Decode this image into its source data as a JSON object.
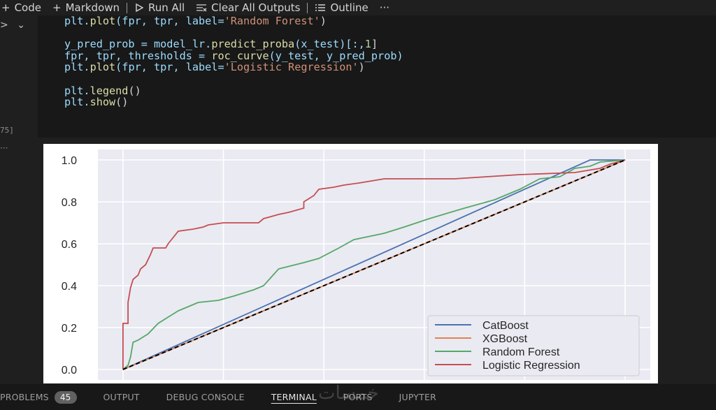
{
  "toolbar": {
    "code_label": "Code",
    "markdown_label": "Markdown",
    "run_all_label": "Run All",
    "clear_outputs_label": "Clear All Outputs",
    "outline_label": "Outline",
    "more_label": "···"
  },
  "cell": {
    "execution_count": "75]",
    "lines": {
      "l1": {
        "a": "plt.",
        "b": "plot",
        "c": "(fpr, tpr, label=",
        "d": "'Random Forest'",
        "e": ")"
      },
      "l3": {
        "a": "y_pred_prob = model_lr.",
        "b": "predict_proba",
        "c": "(x_test)[:,",
        "d": "1",
        "e": "]"
      },
      "l4": {
        "a": "fpr, tpr, thresholds = ",
        "b": "roc_curve",
        "c": "(y_test, y_pred_prob)"
      },
      "l5": {
        "a": "plt.",
        "b": "plot",
        "c": "(fpr, tpr, label=",
        "d": "'Logistic Regression'",
        "e": ")"
      },
      "l7": {
        "a": "plt.",
        "b": "legend",
        "c": "()"
      },
      "l8": {
        "a": "plt.",
        "b": "show",
        "c": "()"
      }
    }
  },
  "output_gutter": "···",
  "chart_data": {
    "type": "line",
    "xlim": [
      -0.05,
      1.05
    ],
    "ylim": [
      -0.05,
      1.05
    ],
    "y_ticks": [
      "0.0",
      "0.2",
      "0.4",
      "0.6",
      "0.8",
      "1.0"
    ],
    "y_tick_values": [
      0,
      0.2,
      0.4,
      0.6,
      0.8,
      1.0
    ],
    "x_grid_values": [
      0,
      0.2,
      0.4,
      0.6,
      0.8,
      1.0
    ],
    "grid": true,
    "background": "#eaeaf2",
    "legend_position": "lower-right",
    "series": [
      {
        "name": "CatBoost",
        "color": "#4c72b0",
        "points": [
          [
            0,
            0
          ],
          [
            0.93,
            1.0
          ],
          [
            1.0,
            1.0
          ]
        ]
      },
      {
        "name": "XGBoost",
        "color": "#dd8452",
        "points": [
          [
            0,
            0
          ],
          [
            1.0,
            1.0
          ]
        ]
      },
      {
        "name": "Random Forest",
        "color": "#55a868",
        "points": [
          [
            0,
            0
          ],
          [
            0.01,
            0.02
          ],
          [
            0.015,
            0.06
          ],
          [
            0.02,
            0.13
          ],
          [
            0.03,
            0.14
          ],
          [
            0.05,
            0.17
          ],
          [
            0.07,
            0.22
          ],
          [
            0.09,
            0.25
          ],
          [
            0.11,
            0.28
          ],
          [
            0.13,
            0.3
          ],
          [
            0.15,
            0.32
          ],
          [
            0.19,
            0.33
          ],
          [
            0.22,
            0.35
          ],
          [
            0.26,
            0.38
          ],
          [
            0.28,
            0.4
          ],
          [
            0.31,
            0.48
          ],
          [
            0.36,
            0.51
          ],
          [
            0.39,
            0.53
          ],
          [
            0.43,
            0.58
          ],
          [
            0.46,
            0.62
          ],
          [
            0.52,
            0.65
          ],
          [
            0.56,
            0.68
          ],
          [
            0.61,
            0.72
          ],
          [
            0.68,
            0.77
          ],
          [
            0.74,
            0.81
          ],
          [
            0.79,
            0.86
          ],
          [
            0.83,
            0.91
          ],
          [
            0.87,
            0.92
          ],
          [
            0.9,
            0.96
          ],
          [
            0.93,
            0.97
          ],
          [
            0.95,
            0.99
          ],
          [
            1.0,
            1.0
          ]
        ]
      },
      {
        "name": "Logistic Regression",
        "color": "#c44e52",
        "points": [
          [
            0,
            0
          ],
          [
            0.0,
            0.22
          ],
          [
            0.01,
            0.22
          ],
          [
            0.01,
            0.32
          ],
          [
            0.015,
            0.39
          ],
          [
            0.02,
            0.43
          ],
          [
            0.03,
            0.45
          ],
          [
            0.035,
            0.48
          ],
          [
            0.045,
            0.5
          ],
          [
            0.055,
            0.55
          ],
          [
            0.06,
            0.58
          ],
          [
            0.085,
            0.58
          ],
          [
            0.09,
            0.6
          ],
          [
            0.1,
            0.63
          ],
          [
            0.11,
            0.66
          ],
          [
            0.14,
            0.67
          ],
          [
            0.16,
            0.68
          ],
          [
            0.17,
            0.69
          ],
          [
            0.2,
            0.7
          ],
          [
            0.27,
            0.7
          ],
          [
            0.28,
            0.72
          ],
          [
            0.31,
            0.74
          ],
          [
            0.33,
            0.75
          ],
          [
            0.36,
            0.77
          ],
          [
            0.36,
            0.8
          ],
          [
            0.38,
            0.83
          ],
          [
            0.39,
            0.86
          ],
          [
            0.42,
            0.87
          ],
          [
            0.44,
            0.88
          ],
          [
            0.47,
            0.89
          ],
          [
            0.52,
            0.91
          ],
          [
            0.66,
            0.91
          ],
          [
            0.79,
            0.93
          ],
          [
            0.9,
            0.94
          ],
          [
            0.95,
            0.96
          ],
          [
            0.97,
            0.98
          ],
          [
            1.0,
            1.0
          ]
        ]
      },
      {
        "name": "",
        "color": "#000000",
        "dashed": true,
        "points": [
          [
            0,
            0
          ],
          [
            1.0,
            1.0
          ]
        ]
      }
    ]
  },
  "panel_tabs": {
    "problems": "PROBLEMS",
    "problems_count": "45",
    "output": "OUTPUT",
    "debug_console": "DEBUG CONSOLE",
    "terminal": "TERMINAL",
    "ports": "PORTS",
    "jupyter": "JUPYTER"
  },
  "watermark": "خمسات"
}
